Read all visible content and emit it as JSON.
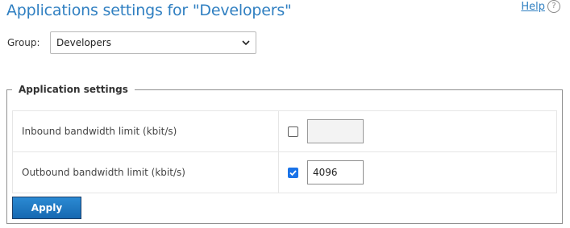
{
  "header": {
    "title": "Applications settings for \"Developers\"",
    "help_label": "Help",
    "help_icon_glyph": "?"
  },
  "group": {
    "label": "Group:",
    "selected": "Developers",
    "icon": "chevron-down-icon"
  },
  "settings": {
    "legend": "Application settings",
    "rows": [
      {
        "label": "Inbound bandwidth limit (kbit/s)",
        "checked": false,
        "value": ""
      },
      {
        "label": "Outbound bandwidth limit (kbit/s)",
        "checked": true,
        "value": "4096"
      }
    ]
  },
  "actions": {
    "apply_label": "Apply"
  },
  "colors": {
    "title": "#2f7fc1",
    "checkbox_checked": "#1a73e8",
    "button": "#1668b1"
  }
}
